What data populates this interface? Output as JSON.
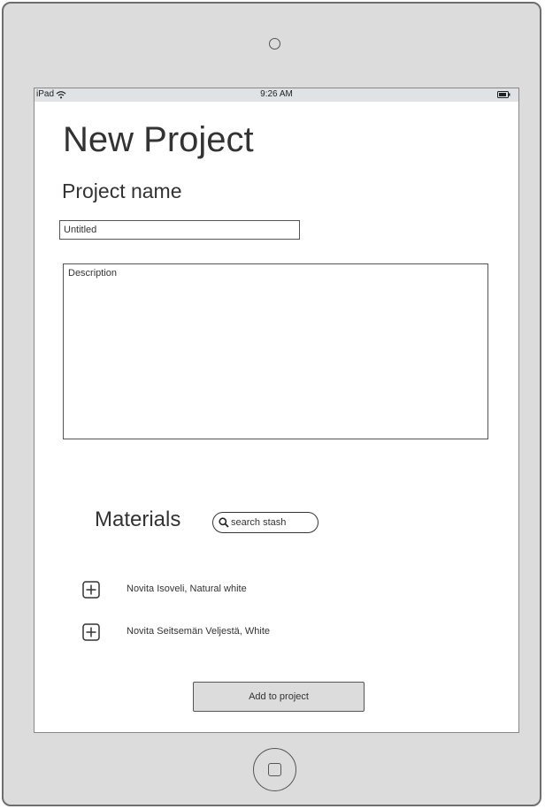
{
  "status_bar": {
    "carrier": "iPad",
    "time": "9:26 AM",
    "wifi_icon": "wifi-icon",
    "battery_icon": "battery-icon"
  },
  "page": {
    "title": "New Project",
    "project_name_label": "Project name"
  },
  "form": {
    "name_value": "Untitled",
    "description_placeholder": "Description"
  },
  "materials": {
    "heading": "Materials",
    "search_placeholder": "search stash",
    "search_icon": "search-icon",
    "items": [
      {
        "label": "Novita Isoveli, Natural white",
        "icon": "plus-icon"
      },
      {
        "label": "Novita Seitsemän Veljestä, White",
        "icon": "plus-icon"
      }
    ],
    "add_button_label": "Add to project"
  },
  "device": {
    "camera_icon": "camera-icon",
    "home_icon": "home-button-icon"
  },
  "colors": {
    "device_frame": "#dcdcdc",
    "status_bar": "#dfe3e6",
    "button": "#dcdcdc",
    "text": "#333333"
  }
}
